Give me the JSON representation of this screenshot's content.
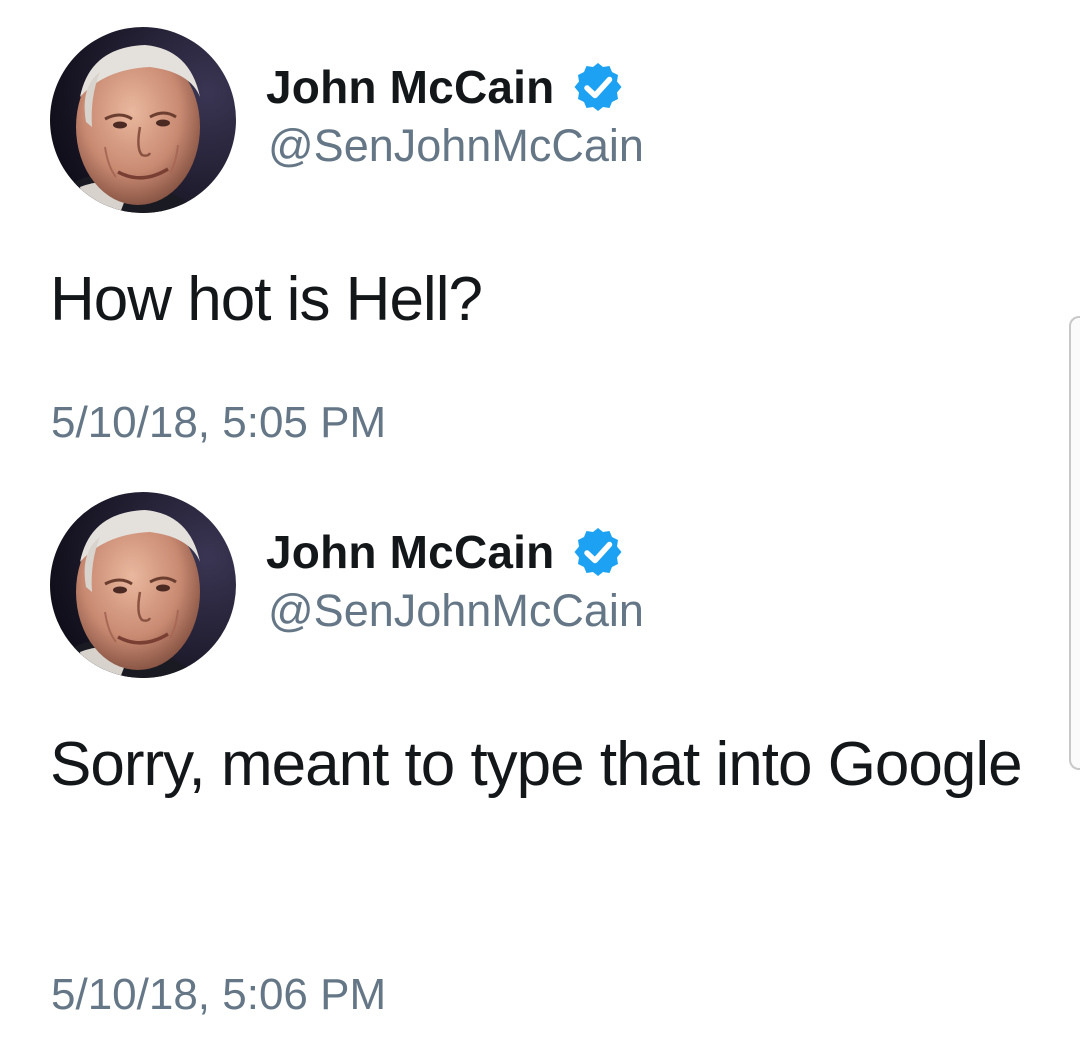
{
  "tweets": [
    {
      "display_name": "John McCain",
      "handle": "@SenJohnMcCain",
      "verified": true,
      "text": "How hot is Hell?",
      "timestamp": "5/10/18, 5:05 PM"
    },
    {
      "display_name": "John McCain",
      "handle": "@SenJohnMcCain",
      "verified": true,
      "text": "Sorry, meant to type that into Google",
      "timestamp": "5/10/18, 5:06 PM"
    }
  ],
  "icons": {
    "verified": "verified-badge-icon",
    "avatar": "profile-avatar"
  },
  "colors": {
    "text_primary": "#14171a",
    "text_secondary": "#657786",
    "verified_blue": "#1da1f2",
    "background": "#ffffff"
  }
}
